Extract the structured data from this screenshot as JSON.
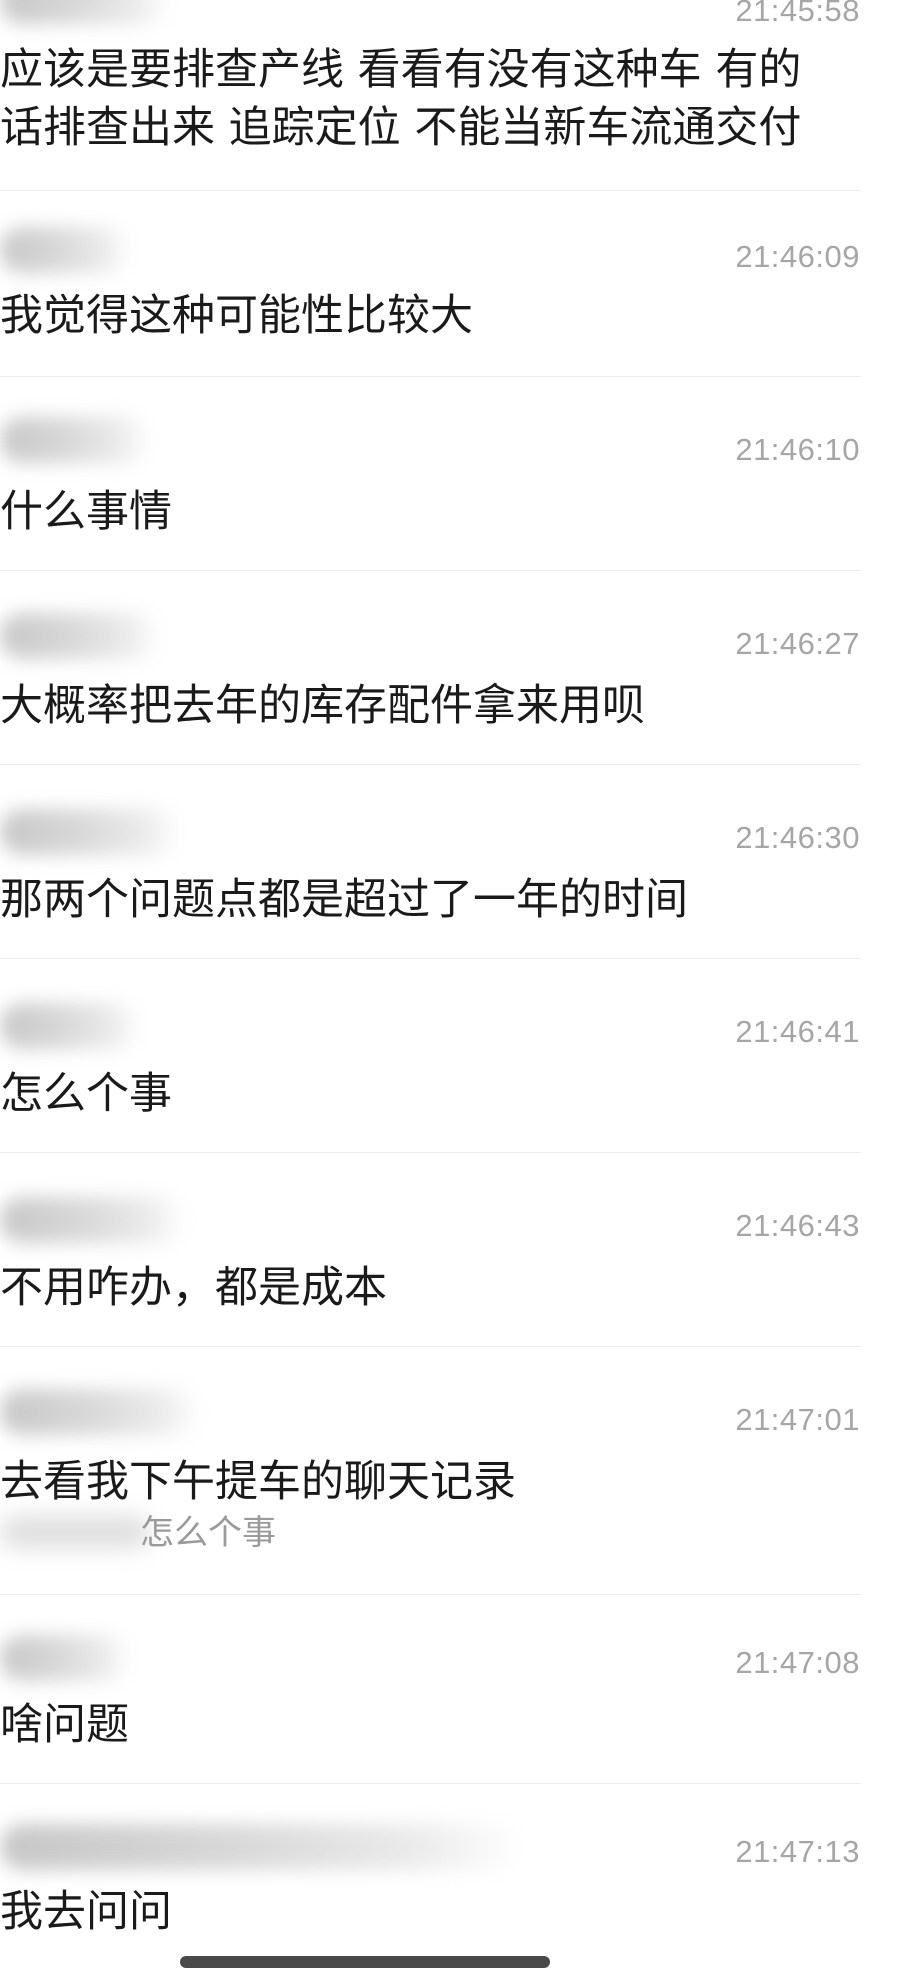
{
  "messages": [
    {
      "time": "21:45:58",
      "text_lines": [
        "应该是要排查产线 看看有没有这种车 有的",
        "话排查出来 追踪定位 不能当新车流通交付"
      ]
    },
    {
      "time": "21:46:09",
      "text_lines": [
        "我觉得这种可能性比较大"
      ]
    },
    {
      "time": "21:46:10",
      "text_lines": [
        "什么事情"
      ]
    },
    {
      "time": "21:46:27",
      "text_lines": [
        "大概率把去年的库存配件拿来用呗"
      ]
    },
    {
      "time": "21:46:30",
      "text_lines": [
        "那两个问题点都是超过了一年的时间"
      ]
    },
    {
      "time": "21:46:41",
      "text_lines": [
        "怎么个事"
      ]
    },
    {
      "time": "21:46:43",
      "text_lines": [
        "不用咋办，都是成本"
      ]
    },
    {
      "time": "21:47:01",
      "text_lines": [
        "去看我下午提车的聊天记录"
      ],
      "quote": "怎么个事"
    },
    {
      "time": "21:47:08",
      "text_lines": [
        "啥问题"
      ]
    },
    {
      "time": "21:47:13",
      "text_lines": [
        "我去问问"
      ]
    }
  ]
}
